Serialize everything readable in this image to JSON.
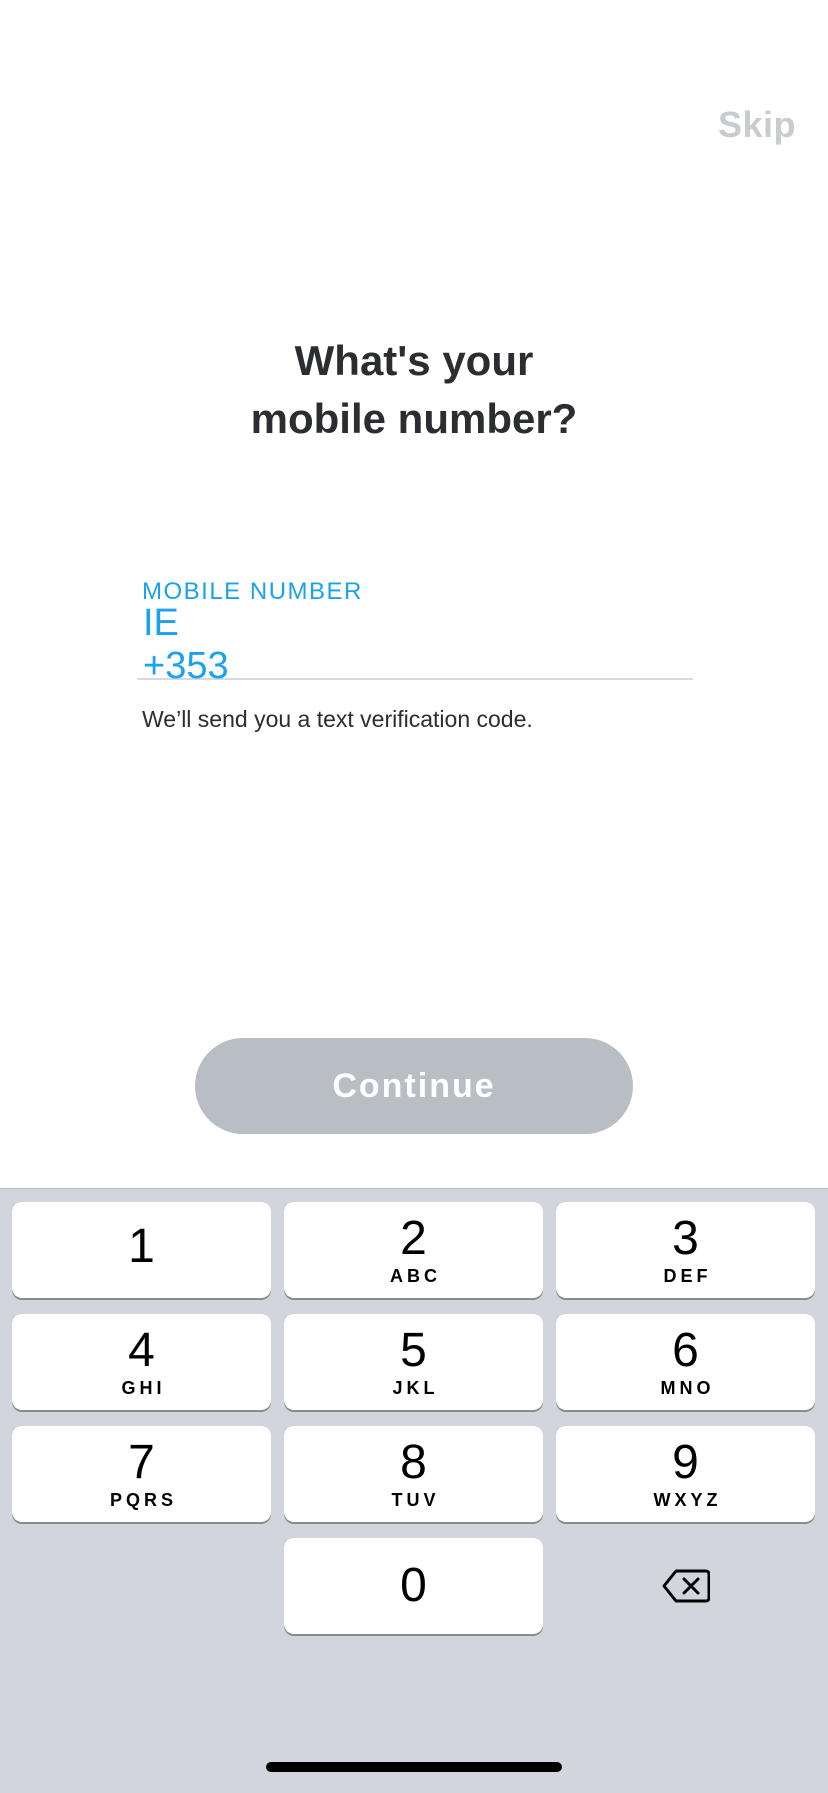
{
  "header": {
    "skip_label": "Skip"
  },
  "title": {
    "line1": "What's your",
    "line2": "mobile number?"
  },
  "phone": {
    "label": "MOBILE NUMBER",
    "country_code": "IE +353",
    "value": "",
    "helper": "We’ll send you a text verification code."
  },
  "continue_label": "Continue",
  "keypad": {
    "keys": [
      {
        "digit": "1",
        "letters": ""
      },
      {
        "digit": "2",
        "letters": "ABC"
      },
      {
        "digit": "3",
        "letters": "DEF"
      },
      {
        "digit": "4",
        "letters": "GHI"
      },
      {
        "digit": "5",
        "letters": "JKL"
      },
      {
        "digit": "6",
        "letters": "MNO"
      },
      {
        "digit": "7",
        "letters": "PQRS"
      },
      {
        "digit": "8",
        "letters": "TUV"
      },
      {
        "digit": "9",
        "letters": "WXYZ"
      },
      {
        "digit": "0",
        "letters": ""
      }
    ],
    "delete_icon": "backspace-icon"
  },
  "colors": {
    "accent": "#1aa2ec",
    "button_disabled": "#b9bec5",
    "keypad_bg": "#d2d5db",
    "skip": "#c8cbd0"
  }
}
